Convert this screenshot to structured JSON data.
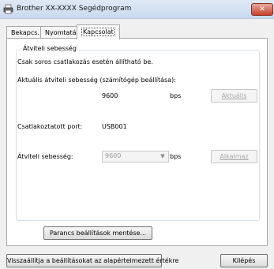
{
  "window": {
    "title": "Brother XX-XXXX Segédprogram",
    "close_label": "✕"
  },
  "tabs": [
    {
      "label": "Bekapcs."
    },
    {
      "label": "Nyomtatás"
    },
    {
      "label": "Kapcsolat"
    }
  ],
  "group": {
    "title": "Átviteli sebesség",
    "note": "Csak soros csatlakozás esetén állítható be.",
    "current_label": "Aktuális átviteli sebesség (számítógép beállítása):",
    "current_value": "9600",
    "current_unit": "bps",
    "current_button": "Aktuális",
    "port_label": "Csatlakoztatott port:",
    "port_value": "USB001",
    "speed_label": "Átviteli sebesség:",
    "speed_selected": "9600",
    "speed_unit": "bps",
    "apply_button": "Alkalmaz"
  },
  "save_button": "Parancs beállítások mentése...",
  "footer": {
    "reset_button": "Visszaállítja a beállításokat az alapértelmezett értékre",
    "exit_button": "Kilépés"
  }
}
